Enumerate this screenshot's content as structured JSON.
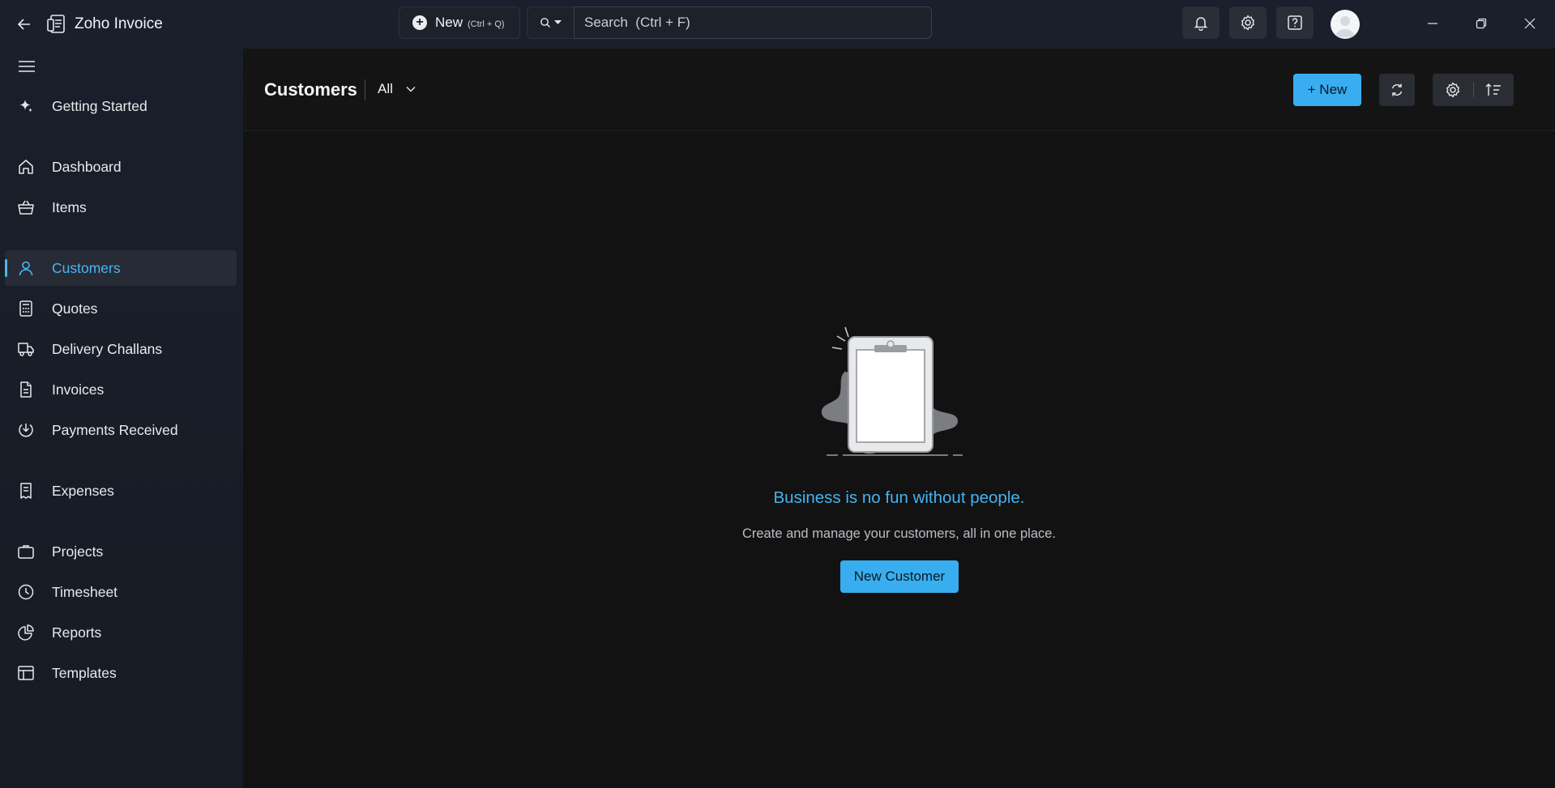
{
  "app": {
    "title": "Zoho Invoice"
  },
  "topbar": {
    "new_label": "New",
    "new_shortcut": "(Ctrl + Q)",
    "search_placeholder": "Search  (Ctrl + F)"
  },
  "sidebar": {
    "items": [
      {
        "label": "Getting Started",
        "icon": "sparkle-icon"
      },
      {
        "label": "Dashboard",
        "icon": "home-icon"
      },
      {
        "label": "Items",
        "icon": "basket-icon"
      },
      {
        "label": "Customers",
        "icon": "user-icon",
        "active": true
      },
      {
        "label": "Quotes",
        "icon": "calculator-icon"
      },
      {
        "label": "Delivery Challans",
        "icon": "truck-icon"
      },
      {
        "label": "Invoices",
        "icon": "document-icon"
      },
      {
        "label": "Payments Received",
        "icon": "payment-received-icon"
      },
      {
        "label": "Expenses",
        "icon": "receipt-icon"
      },
      {
        "label": "Projects",
        "icon": "briefcase-icon"
      },
      {
        "label": "Timesheet",
        "icon": "clock-icon"
      },
      {
        "label": "Reports",
        "icon": "pie-chart-icon"
      },
      {
        "label": "Templates",
        "icon": "layout-icon"
      }
    ]
  },
  "main": {
    "title": "Customers",
    "view_filter": "All",
    "new_button": "+ New",
    "empty_state": {
      "title": "Business is no fun without people.",
      "subtitle": "Create and manage your customers, all in one place.",
      "button": "New Customer"
    }
  },
  "colors": {
    "accent": "#38aef0",
    "active_text": "#4cb6f2",
    "main_bg": "#121212"
  }
}
